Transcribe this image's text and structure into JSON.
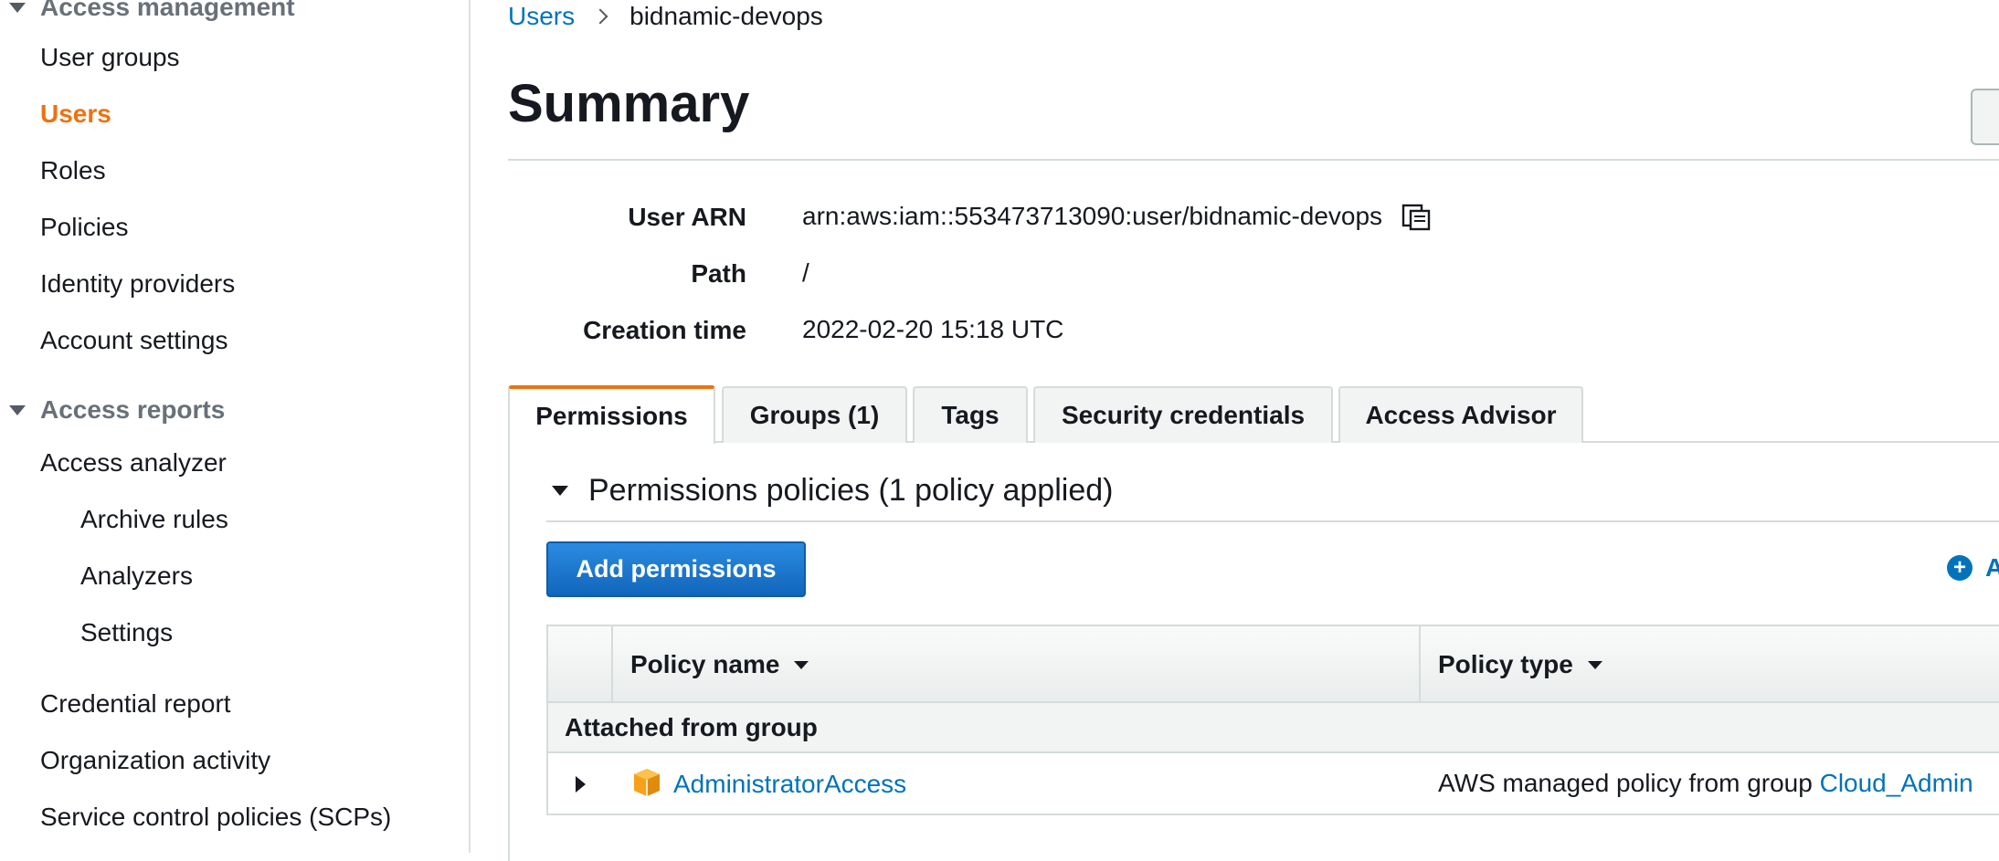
{
  "sidebar": {
    "section_access_management": "Access management",
    "items_top": [
      {
        "label": "User groups"
      },
      {
        "label": "Users"
      },
      {
        "label": "Roles"
      },
      {
        "label": "Policies"
      },
      {
        "label": "Identity providers"
      },
      {
        "label": "Account settings"
      }
    ],
    "section_access_reports": "Access reports",
    "access_analyzer": "Access analyzer",
    "analyzer_sub": [
      {
        "label": "Archive rules"
      },
      {
        "label": "Analyzers"
      },
      {
        "label": "Settings"
      }
    ],
    "items_bottom": [
      {
        "label": "Credential report"
      },
      {
        "label": "Organization activity"
      },
      {
        "label": "Service control policies (SCPs)"
      }
    ],
    "active_item": "Users"
  },
  "breadcrumb": {
    "root": "Users",
    "current": "bidnamic-devops"
  },
  "page_title": "Summary",
  "summary": {
    "arn_label": "User ARN",
    "arn_value": "arn:aws:iam::553473713090:user/bidnamic-devops",
    "path_label": "Path",
    "path_value": "/",
    "creation_label": "Creation time",
    "creation_value": "2022-02-20 15:18 UTC"
  },
  "tabs": [
    {
      "label": "Permissions",
      "active": true
    },
    {
      "label": "Groups (1)",
      "active": false
    },
    {
      "label": "Tags",
      "active": false
    },
    {
      "label": "Security credentials",
      "active": false
    },
    {
      "label": "Access Advisor",
      "active": false
    }
  ],
  "permissions": {
    "section_title": "Permissions policies (1 policy applied)",
    "add_button": "Add permissions",
    "add_inline_label": "A",
    "table": {
      "col_policy_name": "Policy name",
      "col_policy_type": "Policy type",
      "group_row_label": "Attached from group",
      "rows": [
        {
          "policy_name": "AdministratorAccess",
          "policy_type_text": "AWS managed policy from group",
          "group_link": "Cloud_Admin"
        }
      ]
    }
  },
  "colors": {
    "accent": "#ec7211",
    "link": "#0073bb",
    "primary_button": "#1166bb"
  }
}
